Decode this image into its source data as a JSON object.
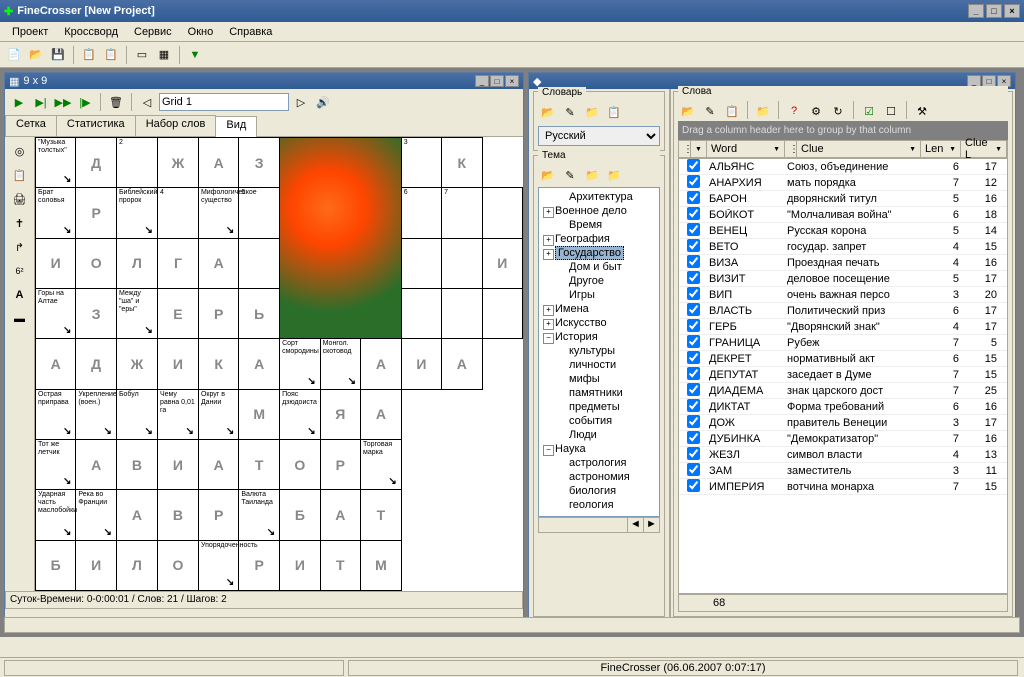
{
  "app": {
    "title": "FineCrosser [New Project]"
  },
  "menu": [
    "Проект",
    "Кроссворд",
    "Сервис",
    "Окно",
    "Справка"
  ],
  "leftWindow": {
    "title": "9 x 9",
    "gridName": "Grid 1",
    "tabs": [
      "Сетка",
      "Статистика",
      "Набор слов",
      "Вид"
    ],
    "activeTab": 3,
    "status": "Суток-Времени: 0-0:00:01 / Слов: 21 / Шагов: 2"
  },
  "crossword": [
    [
      {
        "c": "\"Музыка толстых\""
      },
      {
        "l": "Д"
      },
      {
        "n": "2"
      },
      {
        "l": "Ж"
      },
      {
        "l": "А"
      },
      {
        "l": "З"
      },
      {
        "img": true,
        "rs": 4,
        "cs": 3
      },
      {
        "n": "3"
      },
      {
        "l": "К"
      }
    ],
    [
      {
        "c": "Брат соловья"
      },
      {
        "l": "Р"
      },
      {
        "c": "Библейский пророк"
      },
      {
        "n": "4"
      },
      {
        "c": "Мифологическое существо"
      },
      {
        "n": "5"
      },
      {
        "n": "6"
      },
      {
        "n": "7"
      },
      {}
    ],
    [
      {
        "l": "И"
      },
      {
        "l": "О"
      },
      {
        "l": "Л"
      },
      {
        "l": "Г"
      },
      {
        "l": "А"
      },
      {},
      {},
      {},
      {
        "l": "И"
      }
    ],
    [
      {
        "c": "Горы на Алтае"
      },
      {
        "l": "З"
      },
      {
        "c": "Между \"ша\" и \"еры\""
      },
      {
        "l": "Е"
      },
      {
        "l": "Р"
      },
      {
        "l": "Ь"
      },
      {},
      {},
      {}
    ],
    [
      {
        "l": "А"
      },
      {
        "l": "Д"
      },
      {
        "l": "Ж"
      },
      {
        "l": "И"
      },
      {
        "l": "К"
      },
      {
        "l": "А"
      },
      {
        "c": "Сорт смородины"
      },
      {
        "c": "Монгол. скотовод"
      },
      {
        "l": "А"
      },
      {
        "l": "И"
      },
      {
        "l": "А"
      }
    ],
    [
      {
        "c": "Острая приправа"
      },
      {
        "c": "Укрепление (воен.)"
      },
      {
        "c": "Бобул"
      },
      {
        "c": "Чему равна 0,01 га"
      },
      {
        "c": "Округ в Дании"
      },
      {
        "l": "М"
      },
      {
        "c": "Пояс дзюдоиста"
      },
      {
        "l": "Я"
      },
      {
        "l": "А"
      }
    ],
    [
      {
        "c": "Тот же летчик"
      },
      {
        "l": "А"
      },
      {
        "l": "В"
      },
      {
        "l": "И"
      },
      {
        "l": "А"
      },
      {
        "l": "Т"
      },
      {
        "l": "О"
      },
      {
        "l": "Р"
      },
      {
        "c": "Торговая марка"
      }
    ],
    [
      {
        "c": "Ударная часть маслобойки"
      },
      {
        "c": "Река во Франции"
      },
      {
        "l": "А"
      },
      {
        "l": "В"
      },
      {
        "l": "Р"
      },
      {
        "c": "Валюта Таиланда"
      },
      {
        "l": "Б"
      },
      {
        "l": "А"
      },
      {
        "l": "Т"
      }
    ],
    [
      {
        "l": "Б"
      },
      {
        "l": "И"
      },
      {
        "l": "Л"
      },
      {
        "l": "О"
      },
      {
        "c": "Упорядоченность"
      },
      {
        "l": "Р"
      },
      {
        "l": "И"
      },
      {
        "l": "Т"
      },
      {
        "l": "М"
      }
    ]
  ],
  "dict": {
    "title": "Словарь",
    "language": "Русский",
    "themeLabel": "Тема",
    "tree": [
      {
        "t": "Архитектура",
        "k": "leaf"
      },
      {
        "t": "Военное дело",
        "k": "col"
      },
      {
        "t": "Время",
        "k": "leaf"
      },
      {
        "t": "География",
        "k": "col"
      },
      {
        "t": "Государство",
        "k": "col",
        "sel": true
      },
      {
        "t": "Дом и быт",
        "k": "leaf"
      },
      {
        "t": "Другое",
        "k": "leaf"
      },
      {
        "t": "Игры",
        "k": "leaf"
      },
      {
        "t": "Имена",
        "k": "col"
      },
      {
        "t": "Искусство",
        "k": "col"
      },
      {
        "t": "История",
        "k": "exp"
      },
      {
        "t": "культуры",
        "k": "leaf",
        "i": 1
      },
      {
        "t": "личности",
        "k": "leaf",
        "i": 1
      },
      {
        "t": "мифы",
        "k": "leaf",
        "i": 1
      },
      {
        "t": "памятники",
        "k": "leaf",
        "i": 1
      },
      {
        "t": "предметы",
        "k": "leaf",
        "i": 1
      },
      {
        "t": "события",
        "k": "leaf",
        "i": 1
      },
      {
        "t": "Люди",
        "k": "leaf"
      },
      {
        "t": "Наука",
        "k": "exp"
      },
      {
        "t": "астрология",
        "k": "leaf",
        "i": 1
      },
      {
        "t": "астрономия",
        "k": "leaf",
        "i": 1
      },
      {
        "t": "биология",
        "k": "leaf",
        "i": 1
      },
      {
        "t": "геология",
        "k": "leaf",
        "i": 1
      }
    ]
  },
  "words": {
    "title": "Слова",
    "dragHint": "Drag a column header here to group by that column",
    "columns": [
      "Word",
      "Clue",
      "Len",
      "Clue L"
    ],
    "rows": [
      {
        "w": "АЛЬЯНС",
        "c": "Союз, объединение",
        "l": 6,
        "cl": 17
      },
      {
        "w": "АНАРХИЯ",
        "c": "мать порядка",
        "l": 7,
        "cl": 12
      },
      {
        "w": "БАРОН",
        "c": "дворянский титул",
        "l": 5,
        "cl": 16
      },
      {
        "w": "БОЙКОТ",
        "c": "\"Молчаливая война\"",
        "l": 6,
        "cl": 18
      },
      {
        "w": "ВЕНЕЦ",
        "c": "Русская корона",
        "l": 5,
        "cl": 14
      },
      {
        "w": "ВЕТО",
        "c": "государ. запрет",
        "l": 4,
        "cl": 15
      },
      {
        "w": "ВИЗА",
        "c": "Проездная печать",
        "l": 4,
        "cl": 16
      },
      {
        "w": "ВИЗИТ",
        "c": "деловое посещение",
        "l": 5,
        "cl": 17
      },
      {
        "w": "ВИП",
        "c": "очень важная персо",
        "l": 3,
        "cl": 20
      },
      {
        "w": "ВЛАСТЬ",
        "c": "Политический приз",
        "l": 6,
        "cl": 17
      },
      {
        "w": "ГЕРБ",
        "c": "\"Дворянский знак\"",
        "l": 4,
        "cl": 17
      },
      {
        "w": "ГРАНИЦА",
        "c": "Рубеж",
        "l": 7,
        "cl": 5
      },
      {
        "w": "ДЕКРЕТ",
        "c": "нормативный акт",
        "l": 6,
        "cl": 15
      },
      {
        "w": "ДЕПУТАТ",
        "c": "заседает в Думе",
        "l": 7,
        "cl": 15
      },
      {
        "w": "ДИАДЕМА",
        "c": "знак царского дост",
        "l": 7,
        "cl": 25
      },
      {
        "w": "ДИКТАТ",
        "c": "Форма требований",
        "l": 6,
        "cl": 16
      },
      {
        "w": "ДОЖ",
        "c": "правитель Венеции",
        "l": 3,
        "cl": 17
      },
      {
        "w": "ДУБИНКА",
        "c": "\"Демократизатор\"",
        "l": 7,
        "cl": 16
      },
      {
        "w": "ЖЕЗЛ",
        "c": "символ власти",
        "l": 4,
        "cl": 13
      },
      {
        "w": "ЗАМ",
        "c": "заместитель",
        "l": 3,
        "cl": 11
      },
      {
        "w": "ИМПЕРИЯ",
        "c": "вотчина монарха",
        "l": 7,
        "cl": 15
      }
    ],
    "count": "68"
  },
  "statusbar": "FineCrosser (06.06.2007 0:07:17)"
}
